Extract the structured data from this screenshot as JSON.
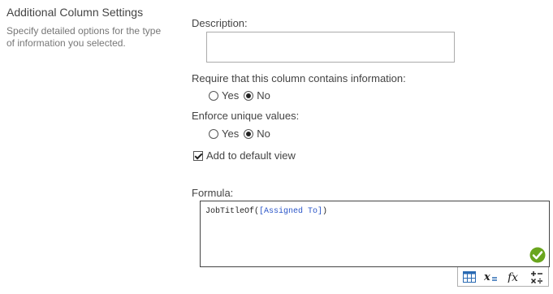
{
  "section": {
    "title": "Additional Column Settings",
    "description": "Specify detailed options for the type of information you selected."
  },
  "description_field": {
    "label": "Description:",
    "value": ""
  },
  "require": {
    "label": "Require that this column contains information:",
    "options": [
      "Yes",
      "No"
    ],
    "selected": "No"
  },
  "unique": {
    "label": "Enforce unique values:",
    "options": [
      "Yes",
      "No"
    ],
    "selected": "No"
  },
  "default_view": {
    "label": "Add to default view",
    "checked": true
  },
  "formula": {
    "label": "Formula:",
    "func": "JobTitleOf(",
    "ref": "[Assigned To]",
    "close": ")",
    "ref_color": "#2a55c8",
    "valid_icon": "check-circle-icon",
    "valid_color": "#6aa51e"
  },
  "toolbar": {
    "items": [
      "table-icon",
      "variable-icon",
      "function-icon",
      "operators-icon"
    ]
  }
}
